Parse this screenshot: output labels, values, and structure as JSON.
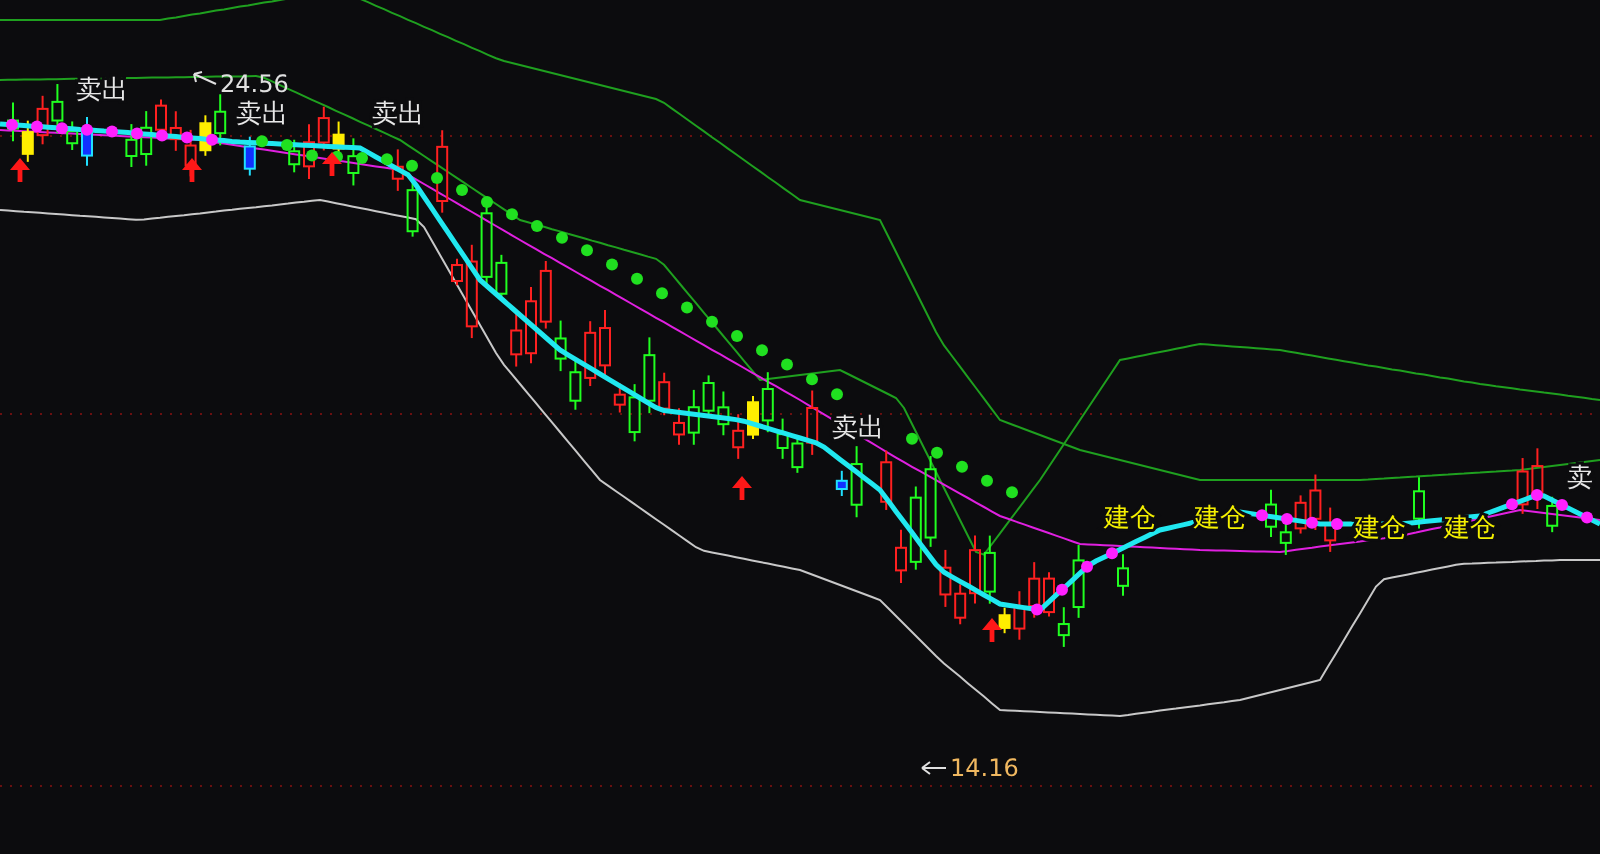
{
  "chart": {
    "signals": [
      {
        "kind": "sell",
        "text": "卖出"
      },
      {
        "kind": "sell",
        "text": "卖出"
      },
      {
        "kind": "sell",
        "text": "卖出"
      },
      {
        "kind": "sell",
        "text": "卖出"
      },
      {
        "kind": "sell",
        "text": "卖"
      },
      {
        "kind": "build",
        "text": "建仓"
      },
      {
        "kind": "build",
        "text": "建仓"
      },
      {
        "kind": "build",
        "text": "建仓"
      },
      {
        "kind": "build",
        "text": "建仓"
      }
    ],
    "price_labels": [
      {
        "kind": "high",
        "text": "24.56"
      },
      {
        "kind": "low",
        "text": "14.16"
      }
    ]
  }
}
